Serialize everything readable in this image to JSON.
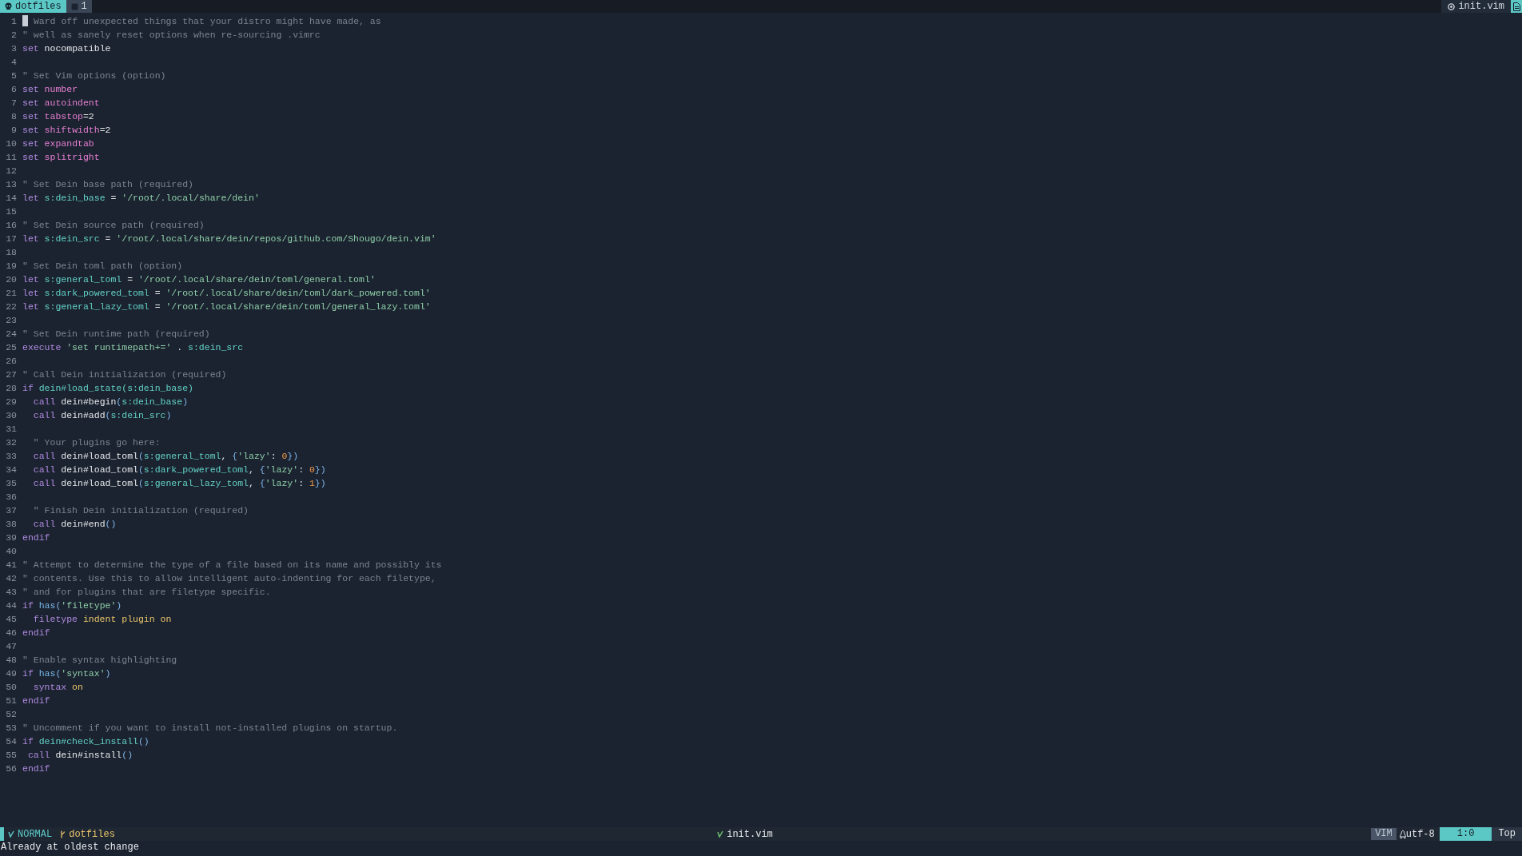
{
  "tabline": {
    "tabs": [
      {
        "label": "dotfiles",
        "selected": true
      },
      {
        "label": "1",
        "selected": false
      }
    ],
    "file": "init.vim"
  },
  "lines": [
    {
      "number": "1",
      "cursor": true,
      "tokens": [
        {
          "kind": "comment",
          "text": " Ward off unexpected things that your distro might have made, as"
        }
      ]
    },
    {
      "number": "2",
      "cursor": false,
      "tokens": [
        {
          "kind": "comment",
          "text": "\" well as sanely reset options when re-sourcing .vimrc"
        }
      ]
    },
    {
      "number": "3",
      "cursor": false,
      "tokens": [
        {
          "kind": "keyword",
          "text": "set"
        },
        {
          "kind": "plain",
          "text": " nocompatible"
        }
      ]
    },
    {
      "number": "4",
      "cursor": false
    },
    {
      "number": "5",
      "cursor": false,
      "tokens": [
        {
          "kind": "comment",
          "text": "\" Set Vim options (option)"
        }
      ]
    },
    {
      "number": "6",
      "cursor": false,
      "tokens": [
        {
          "kind": "keyword",
          "text": "set"
        },
        {
          "kind": "option",
          "text": " number"
        }
      ]
    },
    {
      "number": "7",
      "cursor": false,
      "tokens": [
        {
          "kind": "keyword",
          "text": "set"
        },
        {
          "kind": "option",
          "text": " autoindent"
        }
      ]
    },
    {
      "number": "8",
      "cursor": false,
      "tokens": [
        {
          "kind": "keyword",
          "text": "set"
        },
        {
          "kind": "option",
          "text": " tabstop"
        },
        {
          "kind": "plain",
          "text": "=2"
        }
      ]
    },
    {
      "number": "9",
      "cursor": false,
      "tokens": [
        {
          "kind": "keyword",
          "text": "set"
        },
        {
          "kind": "option",
          "text": " shiftwidth"
        },
        {
          "kind": "plain",
          "text": "=2"
        }
      ]
    },
    {
      "number": "10",
      "cursor": false,
      "tokens": [
        {
          "kind": "keyword",
          "text": "set"
        },
        {
          "kind": "option",
          "text": " expandtab"
        }
      ]
    },
    {
      "number": "11",
      "cursor": false,
      "tokens": [
        {
          "kind": "keyword",
          "text": "set"
        },
        {
          "kind": "option",
          "text": " splitright"
        }
      ]
    },
    {
      "number": "12",
      "cursor": false
    },
    {
      "number": "13",
      "cursor": false,
      "tokens": [
        {
          "kind": "comment",
          "text": "\" Set Dein base path (required)"
        }
      ]
    },
    {
      "number": "14",
      "cursor": false,
      "tokens": [
        {
          "kind": "keyword",
          "text": "let"
        },
        {
          "kind": "variable",
          "text": " s:dein_base"
        },
        {
          "kind": "plain",
          "text": " = "
        },
        {
          "kind": "string",
          "text": "'/root/.local/share/dein'"
        }
      ]
    },
    {
      "number": "15",
      "cursor": false
    },
    {
      "number": "16",
      "cursor": false,
      "tokens": [
        {
          "kind": "comment",
          "text": "\" Set Dein source path (required)"
        }
      ]
    },
    {
      "number": "17",
      "cursor": false,
      "tokens": [
        {
          "kind": "keyword",
          "text": "let"
        },
        {
          "kind": "variable",
          "text": " s:dein_src"
        },
        {
          "kind": "plain",
          "text": " = "
        },
        {
          "kind": "string",
          "text": "'/root/.local/share/dein/repos/github.com/Shougo/dein.vim'"
        }
      ]
    },
    {
      "number": "18",
      "cursor": false
    },
    {
      "number": "19",
      "cursor": false,
      "tokens": [
        {
          "kind": "comment",
          "text": "\" Set Dein toml path (option)"
        }
      ]
    },
    {
      "number": "20",
      "cursor": false,
      "tokens": [
        {
          "kind": "keyword",
          "text": "let"
        },
        {
          "kind": "variable",
          "text": " s:general_toml"
        },
        {
          "kind": "plain",
          "text": " = "
        },
        {
          "kind": "string",
          "text": "'/root/.local/share/dein/toml/general.toml'"
        }
      ]
    },
    {
      "number": "21",
      "cursor": false,
      "tokens": [
        {
          "kind": "keyword",
          "text": "let"
        },
        {
          "kind": "variable",
          "text": " s:dark_powered_toml"
        },
        {
          "kind": "plain",
          "text": " = "
        },
        {
          "kind": "string",
          "text": "'/root/.local/share/dein/toml/dark_powered.toml'"
        }
      ]
    },
    {
      "number": "22",
      "cursor": false,
      "tokens": [
        {
          "kind": "keyword",
          "text": "let"
        },
        {
          "kind": "variable",
          "text": " s:general_lazy_toml"
        },
        {
          "kind": "plain",
          "text": " = "
        },
        {
          "kind": "string",
          "text": "'/root/.local/share/dein/toml/general_lazy.toml'"
        }
      ]
    },
    {
      "number": "23",
      "cursor": false
    },
    {
      "number": "24",
      "cursor": false,
      "tokens": [
        {
          "kind": "comment",
          "text": "\" Set Dein runtime path (required)"
        }
      ]
    },
    {
      "number": "25",
      "cursor": false,
      "tokens": [
        {
          "kind": "keyword",
          "text": "execute "
        },
        {
          "kind": "string",
          "text": "'set runtimepath+='"
        },
        {
          "kind": "plain",
          "text": " . "
        },
        {
          "kind": "variable",
          "text": "s:dein_src"
        }
      ]
    },
    {
      "number": "26",
      "cursor": false
    },
    {
      "number": "27",
      "cursor": false,
      "tokens": [
        {
          "kind": "comment",
          "text": "\" Call Dein initialization (required)"
        }
      ]
    },
    {
      "number": "28",
      "cursor": false,
      "tokens": [
        {
          "kind": "keyword",
          "text": "if"
        },
        {
          "kind": "variable",
          "text": " dein#load_state(s:dein_base)"
        }
      ]
    },
    {
      "number": "29",
      "cursor": false,
      "tokens": [
        {
          "kind": "keyword",
          "text": "  call"
        },
        {
          "kind": "plain",
          "text": " dein#begin"
        },
        {
          "kind": "paren",
          "text": "("
        },
        {
          "kind": "variable",
          "text": "s:dein_base"
        },
        {
          "kind": "paren",
          "text": ")"
        }
      ]
    },
    {
      "number": "30",
      "cursor": false,
      "tokens": [
        {
          "kind": "keyword",
          "text": "  call"
        },
        {
          "kind": "plain",
          "text": " dein#add"
        },
        {
          "kind": "paren",
          "text": "("
        },
        {
          "kind": "variable",
          "text": "s:dein_src"
        },
        {
          "kind": "paren",
          "text": ")"
        }
      ]
    },
    {
      "number": "31",
      "cursor": false
    },
    {
      "number": "32",
      "cursor": false,
      "tokens": [
        {
          "kind": "comment",
          "text": "  \" Your plugins go here:"
        }
      ]
    },
    {
      "number": "33",
      "cursor": false,
      "tokens": [
        {
          "kind": "keyword",
          "text": "  call"
        },
        {
          "kind": "plain",
          "text": " dein#load_toml"
        },
        {
          "kind": "paren",
          "text": "("
        },
        {
          "kind": "variable",
          "text": "s:general_toml"
        },
        {
          "kind": "plain",
          "text": ", "
        },
        {
          "kind": "paren",
          "text": "{"
        },
        {
          "kind": "string",
          "text": "'lazy'"
        },
        {
          "kind": "plain",
          "text": ": "
        },
        {
          "kind": "number",
          "text": "0"
        },
        {
          "kind": "paren",
          "text": "})"
        }
      ]
    },
    {
      "number": "34",
      "cursor": false,
      "tokens": [
        {
          "kind": "keyword",
          "text": "  call"
        },
        {
          "kind": "plain",
          "text": " dein#load_toml"
        },
        {
          "kind": "paren",
          "text": "("
        },
        {
          "kind": "variable",
          "text": "s:dark_powered_toml"
        },
        {
          "kind": "plain",
          "text": ", "
        },
        {
          "kind": "paren",
          "text": "{"
        },
        {
          "kind": "string",
          "text": "'lazy'"
        },
        {
          "kind": "plain",
          "text": ": "
        },
        {
          "kind": "number",
          "text": "0"
        },
        {
          "kind": "paren",
          "text": "})"
        }
      ]
    },
    {
      "number": "35",
      "cursor": false,
      "tokens": [
        {
          "kind": "keyword",
          "text": "  call"
        },
        {
          "kind": "plain",
          "text": " dein#load_toml"
        },
        {
          "kind": "paren",
          "text": "("
        },
        {
          "kind": "variable",
          "text": "s:general_lazy_toml"
        },
        {
          "kind": "plain",
          "text": ", "
        },
        {
          "kind": "paren",
          "text": "{"
        },
        {
          "kind": "string",
          "text": "'lazy'"
        },
        {
          "kind": "plain",
          "text": ": "
        },
        {
          "kind": "number",
          "text": "1"
        },
        {
          "kind": "paren",
          "text": "})"
        }
      ]
    },
    {
      "number": "36",
      "cursor": false
    },
    {
      "number": "37",
      "cursor": false,
      "tokens": [
        {
          "kind": "comment",
          "text": "  \" Finish Dein initialization (required)"
        }
      ]
    },
    {
      "number": "38",
      "cursor": false,
      "tokens": [
        {
          "kind": "keyword",
          "text": "  call"
        },
        {
          "kind": "plain",
          "text": " dein#end"
        },
        {
          "kind": "paren",
          "text": "()"
        }
      ]
    },
    {
      "number": "39",
      "cursor": false,
      "tokens": [
        {
          "kind": "keyword",
          "text": "endif"
        }
      ]
    },
    {
      "number": "40",
      "cursor": false
    },
    {
      "number": "41",
      "cursor": false,
      "tokens": [
        {
          "kind": "comment",
          "text": "\" Attempt to determine the type of a file based on its name and possibly its"
        }
      ]
    },
    {
      "number": "42",
      "cursor": false,
      "tokens": [
        {
          "kind": "comment",
          "text": "\" contents. Use this to allow intelligent auto-indenting for each filetype,"
        }
      ]
    },
    {
      "number": "43",
      "cursor": false,
      "tokens": [
        {
          "kind": "comment",
          "text": "\" and for plugins that are filetype specific."
        }
      ]
    },
    {
      "number": "44",
      "cursor": false,
      "tokens": [
        {
          "kind": "keyword",
          "text": "if"
        },
        {
          "kind": "func",
          "text": " has"
        },
        {
          "kind": "paren",
          "text": "("
        },
        {
          "kind": "string",
          "text": "'filetype'"
        },
        {
          "kind": "paren",
          "text": ")"
        }
      ]
    },
    {
      "number": "45",
      "cursor": false,
      "tokens": [
        {
          "kind": "keyword",
          "text": "  filetype"
        },
        {
          "kind": "constant",
          "text": " indent plugin on"
        }
      ]
    },
    {
      "number": "46",
      "cursor": false,
      "tokens": [
        {
          "kind": "keyword",
          "text": "endif"
        }
      ]
    },
    {
      "number": "47",
      "cursor": false
    },
    {
      "number": "48",
      "cursor": false,
      "tokens": [
        {
          "kind": "comment",
          "text": "\" Enable syntax highlighting"
        }
      ]
    },
    {
      "number": "49",
      "cursor": false,
      "tokens": [
        {
          "kind": "keyword",
          "text": "if"
        },
        {
          "kind": "func",
          "text": " has"
        },
        {
          "kind": "paren",
          "text": "("
        },
        {
          "kind": "string",
          "text": "'syntax'"
        },
        {
          "kind": "paren",
          "text": ")"
        }
      ]
    },
    {
      "number": "50",
      "cursor": false,
      "tokens": [
        {
          "kind": "keyword",
          "text": "  syntax"
        },
        {
          "kind": "constant",
          "text": " on"
        }
      ]
    },
    {
      "number": "51",
      "cursor": false,
      "tokens": [
        {
          "kind": "keyword",
          "text": "endif"
        }
      ]
    },
    {
      "number": "52",
      "cursor": false
    },
    {
      "number": "53",
      "cursor": false,
      "tokens": [
        {
          "kind": "comment",
          "text": "\" Uncomment if you want to install not-installed plugins on startup."
        }
      ]
    },
    {
      "number": "54",
      "cursor": false,
      "tokens": [
        {
          "kind": "keyword",
          "text": "if"
        },
        {
          "kind": "variable",
          "text": " dein#check_install"
        },
        {
          "kind": "paren",
          "text": "()"
        }
      ]
    },
    {
      "number": "55",
      "cursor": false,
      "tokens": [
        {
          "kind": "keyword",
          "text": " call"
        },
        {
          "kind": "plain",
          "text": " dein#install"
        },
        {
          "kind": "paren",
          "text": "()"
        }
      ]
    },
    {
      "number": "56",
      "cursor": false,
      "tokens": [
        {
          "kind": "keyword",
          "text": "endif"
        }
      ]
    }
  ],
  "status_bar": {
    "mode": "NORMAL",
    "branch": "dotfiles",
    "file": "init.vim",
    "filetype": "VIM",
    "encoding": "utf-8",
    "position": "1:0",
    "scroll": "Top"
  },
  "message": "Already at oldest change"
}
